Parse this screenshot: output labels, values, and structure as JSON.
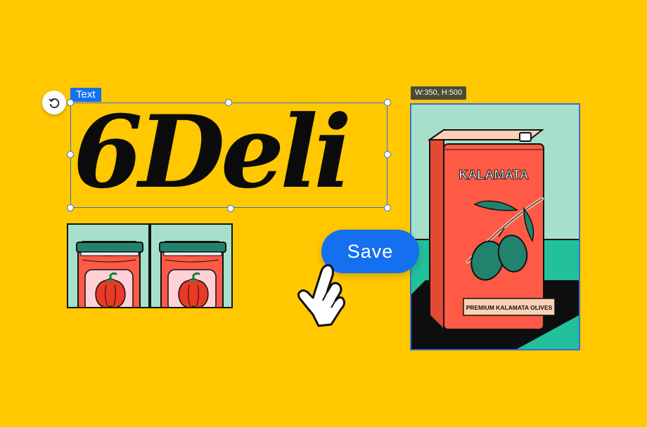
{
  "editor": {
    "text_tag": "Text",
    "text_content": "6Deli",
    "save_label": "Save",
    "image_dimensions": "W:350, H:500"
  },
  "can": {
    "brand": "KALAMATA",
    "label": "PREMIUM KALAMATA OLIVES"
  },
  "icons": {
    "rotate": "rotate-icon",
    "cursor": "pointing-hand-cursor-icon",
    "pepper": "pepper-icon",
    "olive": "olive-branch-icon"
  },
  "colors": {
    "background": "#ffc800",
    "accent": "#1570ef",
    "can_red": "#fe5a45",
    "mint": "#a6e0cb",
    "teal": "#22c09b",
    "jar_lid": "#21836e"
  }
}
